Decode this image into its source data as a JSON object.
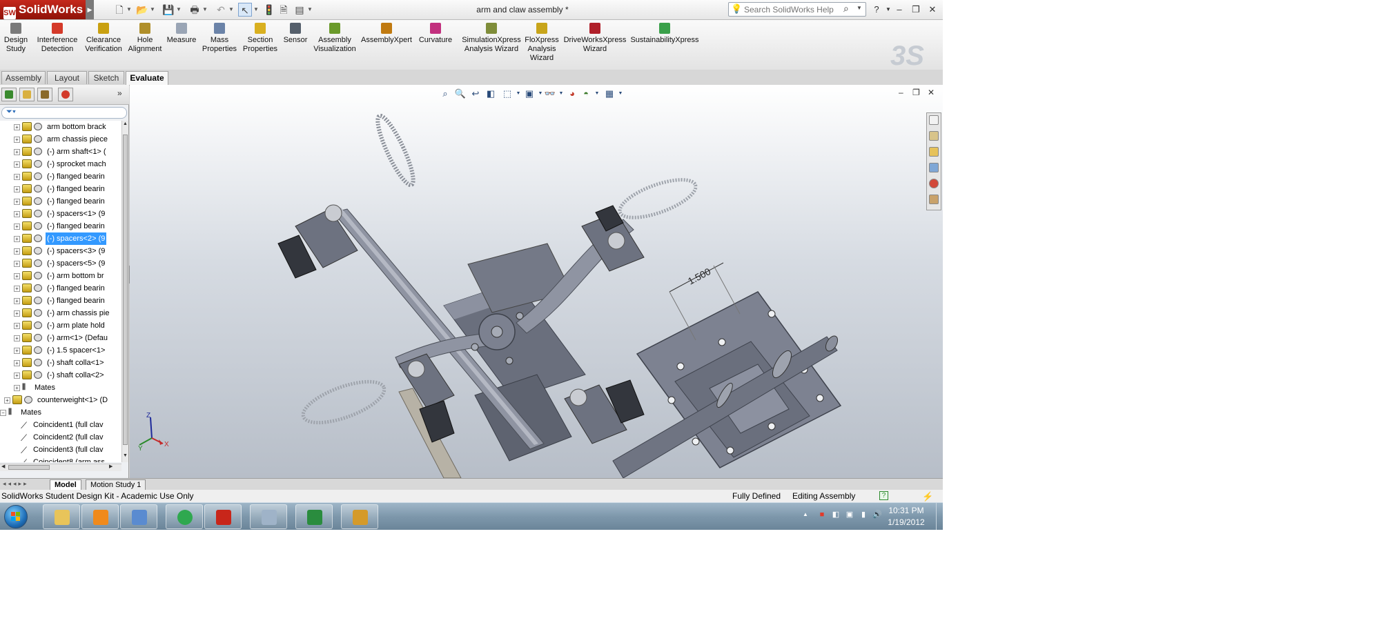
{
  "app": {
    "name": "SolidWorks",
    "document_title": "arm and claw assembly *"
  },
  "help_search": {
    "placeholder": "Search SolidWorks Help"
  },
  "command_manager": [
    {
      "label": "Design\nStudy",
      "icon": "design-study-icon",
      "color": "#7a7a7a"
    },
    {
      "label": "Interference\nDetection",
      "icon": "interference-detection-icon",
      "color": "#d43a2a"
    },
    {
      "label": "Clearance\nVerification",
      "icon": "clearance-verification-icon",
      "color": "#c9a010"
    },
    {
      "label": "Hole\nAlignment",
      "icon": "hole-alignment-icon",
      "color": "#b08f2a"
    },
    {
      "label": "Measure",
      "icon": "measure-icon",
      "color": "#9aa5b5"
    },
    {
      "label": "Mass\nProperties",
      "icon": "mass-properties-icon",
      "color": "#6b83a8"
    },
    {
      "label": "Section\nProperties",
      "icon": "section-properties-icon",
      "color": "#d9b020"
    },
    {
      "label": "Sensor",
      "icon": "sensor-icon",
      "color": "#555f6b"
    },
    {
      "label": "Assembly\nVisualization",
      "icon": "assembly-visualization-icon",
      "color": "#6a9a2a"
    },
    {
      "label": "AssemblyXpert",
      "icon": "assemblyxpert-icon",
      "color": "#c07a10"
    },
    {
      "label": "Curvature",
      "icon": "curvature-icon",
      "color": "#c2307e"
    },
    {
      "label": "SimulationXpress\nAnalysis Wizard",
      "icon": "simulationxpress-icon",
      "color": "#7f8d3a"
    },
    {
      "label": "FloXpress\nAnalysis\nWizard",
      "icon": "floxpress-icon",
      "color": "#c8a51b"
    },
    {
      "label": "DriveWorksXpress\nWizard",
      "icon": "driveworksxpress-icon",
      "color": "#b0202a"
    },
    {
      "label": "SustainabilityXpress",
      "icon": "sustainabilityxpress-icon",
      "color": "#3aa04a"
    }
  ],
  "tabs": [
    {
      "label": "Assembly",
      "active": false
    },
    {
      "label": "Layout",
      "active": false
    },
    {
      "label": "Sketch",
      "active": false
    },
    {
      "label": "Evaluate",
      "active": true
    }
  ],
  "feature_tree": {
    "items": [
      {
        "label": "arm bottom brack",
        "type": "part",
        "indent": 1
      },
      {
        "label": "arm chassis piece",
        "type": "part",
        "indent": 1
      },
      {
        "label": "(-) arm shaft<1> (",
        "type": "part",
        "indent": 1
      },
      {
        "label": "(-) sprocket mach",
        "type": "part",
        "indent": 1
      },
      {
        "label": "(-) flanged bearin",
        "type": "part",
        "indent": 1
      },
      {
        "label": "(-) flanged bearin",
        "type": "part",
        "indent": 1
      },
      {
        "label": "(-) flanged bearin",
        "type": "part",
        "indent": 1
      },
      {
        "label": "(-) spacers<1> (9",
        "type": "part",
        "indent": 1
      },
      {
        "label": "(-) flanged bearin",
        "type": "part",
        "indent": 1
      },
      {
        "label": "(-) spacers<2> (9",
        "type": "part",
        "indent": 1,
        "selected": true
      },
      {
        "label": "(-) spacers<3> (9",
        "type": "part",
        "indent": 1
      },
      {
        "label": "(-) spacers<5> (9",
        "type": "part",
        "indent": 1
      },
      {
        "label": "(-) arm bottom br",
        "type": "part",
        "indent": 1
      },
      {
        "label": "(-) flanged bearin",
        "type": "part",
        "indent": 1
      },
      {
        "label": "(-) flanged bearin",
        "type": "part",
        "indent": 1
      },
      {
        "label": "(-) arm chassis pie",
        "type": "part",
        "indent": 1
      },
      {
        "label": "(-) arm plate hold",
        "type": "part",
        "indent": 1
      },
      {
        "label": "(-) arm<1> (Defau",
        "type": "part",
        "indent": 1
      },
      {
        "label": "(-) 1.5 spacer<1>",
        "type": "part",
        "indent": 1
      },
      {
        "label": "(-) shaft colla<1>",
        "type": "part",
        "indent": 1
      },
      {
        "label": "(-) shaft colla<2>",
        "type": "part",
        "indent": 1
      },
      {
        "label": "Mates",
        "type": "mates",
        "indent": 1
      },
      {
        "label": "counterweight<1> (D",
        "type": "part",
        "indent": 0
      },
      {
        "label": "Mates",
        "type": "mates",
        "indent": -1,
        "expanded": true
      },
      {
        "label": "Coincident1 (full clav",
        "type": "mate",
        "indent": 0
      },
      {
        "label": "Coincident2 (full clav",
        "type": "mate",
        "indent": 0
      },
      {
        "label": "Coincident3 (full clav",
        "type": "mate",
        "indent": 0
      },
      {
        "label": "Coincident8 (arm ass",
        "type": "mate",
        "indent": 0
      }
    ]
  },
  "viewport": {
    "dimension_label": "1.500",
    "triad_labels": {
      "z": "Z",
      "y": "Y",
      "x": "X"
    }
  },
  "bottom_tabs": [
    {
      "label": "Model",
      "active": true
    },
    {
      "label": "Motion Study 1",
      "active": false
    }
  ],
  "status_bar": {
    "left": "SolidWorks Student Design Kit - Academic Use Only",
    "state": "Fully Defined",
    "mode": "Editing Assembly",
    "help_glyph": "?"
  },
  "taskbar": {
    "apps": [
      {
        "name": "windows-explorer",
        "color": "#e8c45a"
      },
      {
        "name": "media-player",
        "color": "#f08a1c"
      },
      {
        "name": "paint-tool",
        "color": "#5a8bd0"
      },
      {
        "name": "chrome",
        "color": "#2fa84f"
      },
      {
        "name": "solidworks",
        "color": "#c8261a"
      },
      {
        "name": "calculator",
        "color": "#9fb3c8"
      },
      {
        "name": "excel",
        "color": "#2a8c3e"
      },
      {
        "name": "misc-app",
        "color": "#d49a2a"
      }
    ],
    "time": "10:31 PM",
    "date": "1/19/2012"
  },
  "colors": {
    "accent": "#3399ff",
    "brand": "#c8261a"
  }
}
